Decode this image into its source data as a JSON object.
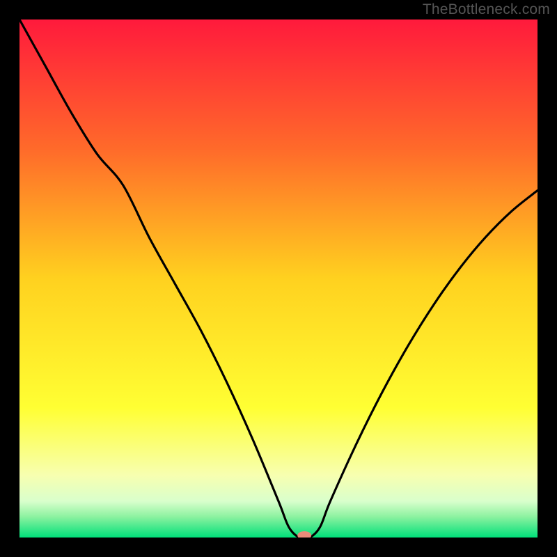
{
  "watermark": "TheBottleneck.com",
  "chart_data": {
    "type": "line",
    "title": "",
    "xlabel": "",
    "ylabel": "",
    "xlim": [
      0,
      100
    ],
    "ylim": [
      0,
      100
    ],
    "x": [
      0,
      5,
      10,
      15,
      20,
      25,
      30,
      35,
      40,
      45,
      50,
      52,
      54,
      56,
      58,
      60,
      65,
      70,
      75,
      80,
      85,
      90,
      95,
      100
    ],
    "values": [
      100,
      91,
      82,
      74,
      68,
      58,
      49,
      40,
      30,
      19,
      7,
      2,
      0,
      0,
      2,
      7,
      18,
      28,
      37,
      45,
      52,
      58,
      63,
      67
    ],
    "background_gradient": {
      "stops": [
        {
          "offset": 0.0,
          "color": "#ff1a3c"
        },
        {
          "offset": 0.25,
          "color": "#ff6a2a"
        },
        {
          "offset": 0.5,
          "color": "#ffd11f"
        },
        {
          "offset": 0.75,
          "color": "#ffff33"
        },
        {
          "offset": 0.88,
          "color": "#f7ffb0"
        },
        {
          "offset": 0.93,
          "color": "#d9ffcc"
        },
        {
          "offset": 0.96,
          "color": "#8cf2a0"
        },
        {
          "offset": 1.0,
          "color": "#00e07a"
        }
      ]
    },
    "marker": {
      "x": 55,
      "y": 0,
      "color": "#e98b7a",
      "rx": 10,
      "ry": 6
    }
  }
}
